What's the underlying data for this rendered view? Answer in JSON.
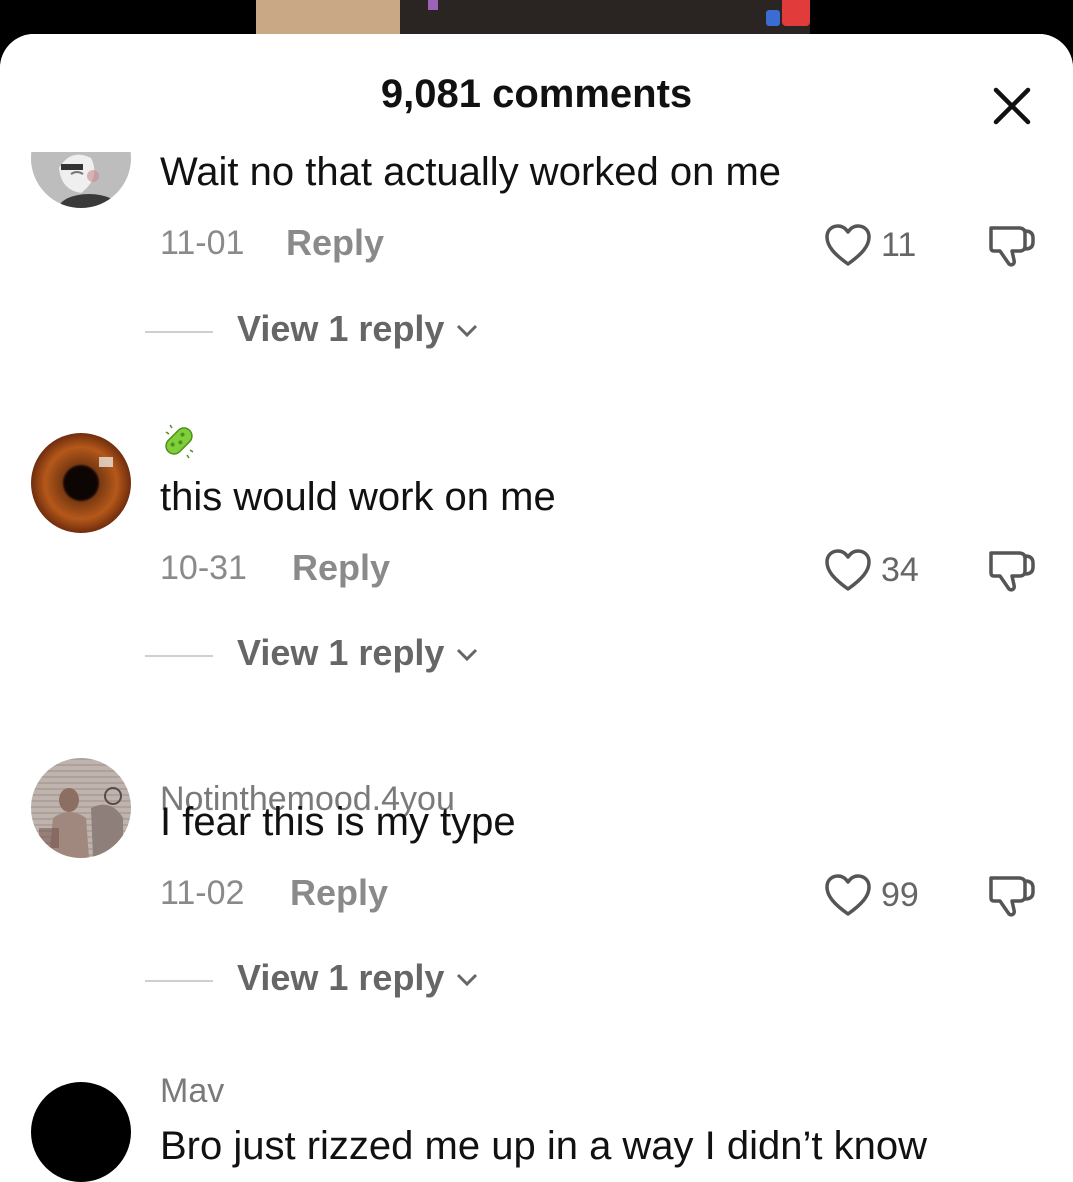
{
  "header": {
    "title": "9,081 comments"
  },
  "comments": [
    {
      "username": "",
      "text": "Wait no that actually worked on me",
      "date": "11-01",
      "reply_label": "Reply",
      "likes": "11",
      "view_replies": "View 1 reply"
    },
    {
      "username": "",
      "text": "this would work on me",
      "date": "10-31",
      "reply_label": "Reply",
      "likes": "34",
      "view_replies": "View 1 reply"
    },
    {
      "username": "Notinthemood.4you",
      "text": "I fear this is my type",
      "date": "11-02",
      "reply_label": "Reply",
      "likes": "99",
      "view_replies": "View 1 reply"
    },
    {
      "username": "Mav",
      "text": "Bro just rizzed me up in a way I didn’t know",
      "date": "",
      "reply_label": "",
      "likes": "",
      "view_replies": ""
    }
  ],
  "icons": {
    "close": "close-icon",
    "like": "heart-outline-icon",
    "dislike": "thumbs-down-icon",
    "chevron": "chevron-down-icon",
    "username_badge": "microbe-emoji-icon"
  },
  "colors": {
    "background": "#ffffff",
    "text_primary": "#111111",
    "text_secondary": "#8a8a8a"
  }
}
